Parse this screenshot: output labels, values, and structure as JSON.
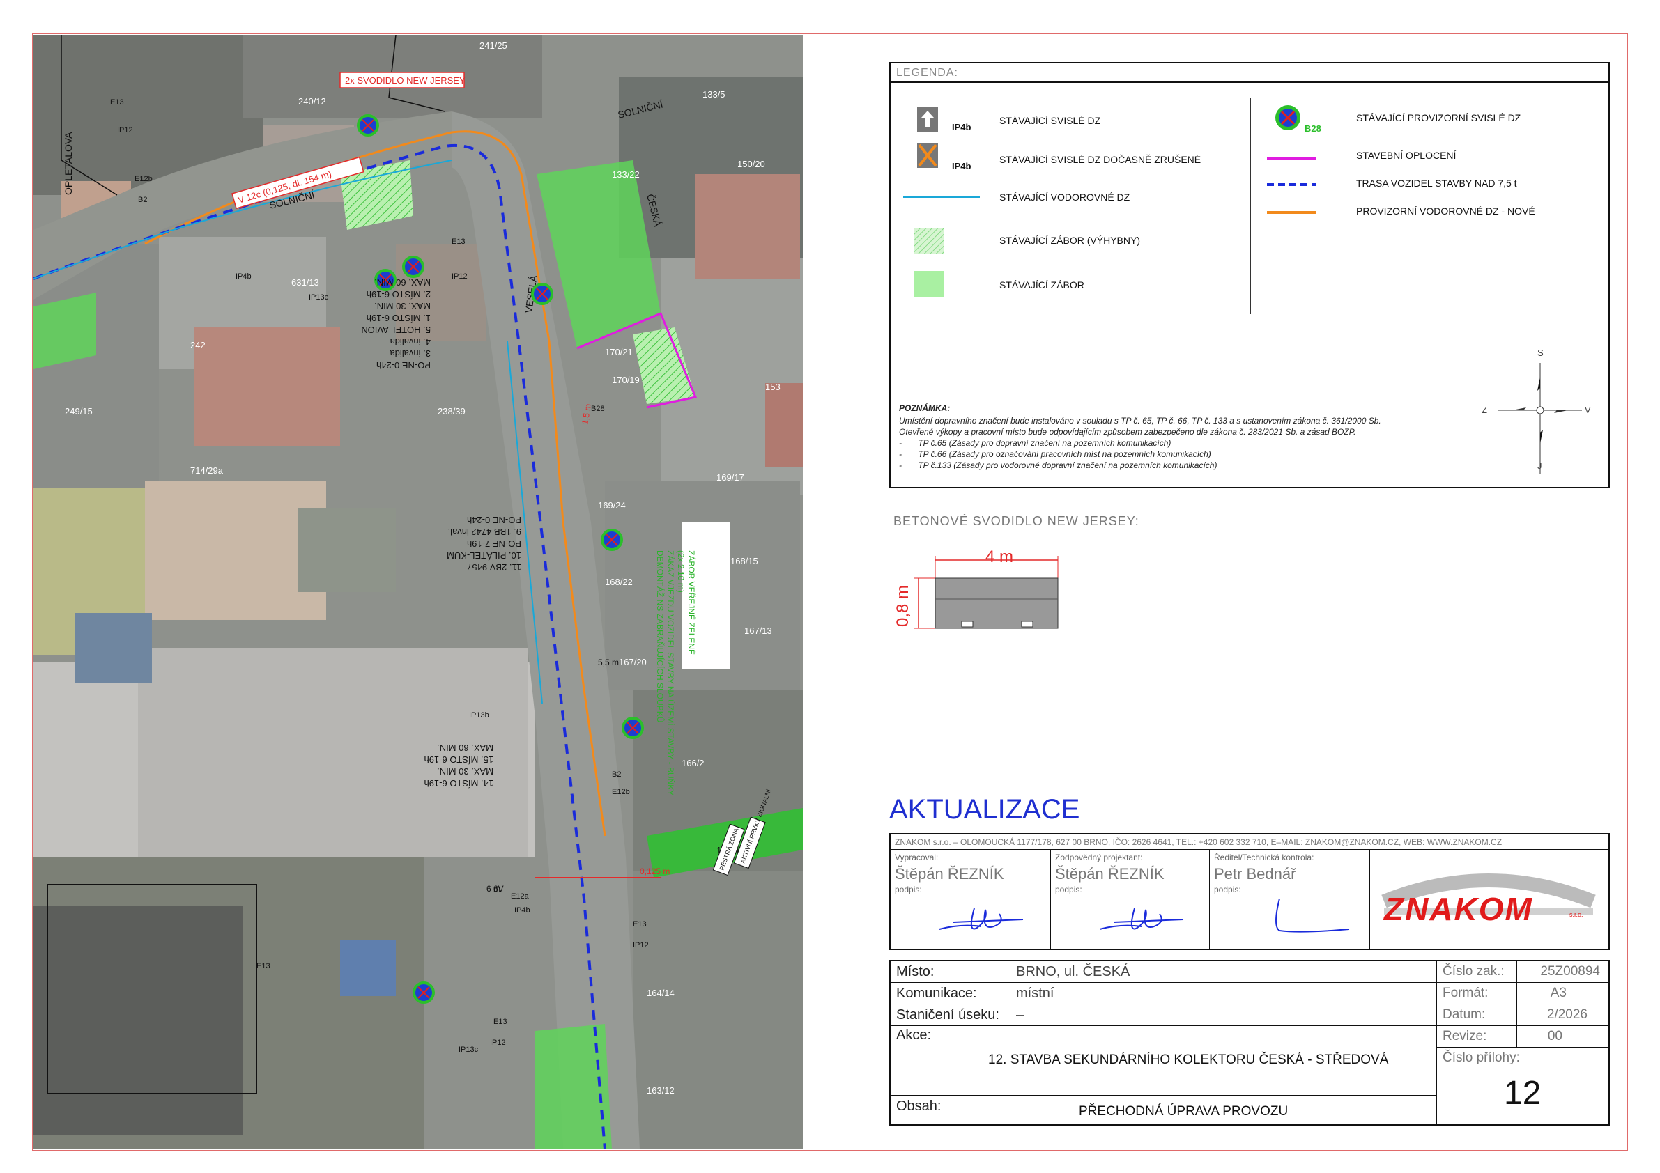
{
  "legend": {
    "header": "LEGENDA:",
    "items": [
      {
        "code": "IP4b",
        "label": "STÁVAJÍCÍ SVISLÉ DZ"
      },
      {
        "code": "IP4b",
        "label": "STÁVAJÍCÍ SVISLÉ DZ DOČASNĚ ZRUŠENÉ"
      },
      {
        "code": "",
        "label": "STÁVAJÍCÍ VODOROVNÉ DZ"
      },
      {
        "code": "",
        "label": "STÁVAJÍCÍ ZÁBOR (VÝHYBNY)"
      },
      {
        "code": "",
        "label": "STÁVAJÍCÍ ZÁBOR"
      },
      {
        "code": "B28",
        "label": "STÁVAJÍCÍ PROVIZORNÍ SVISLÉ DZ"
      },
      {
        "code": "",
        "label": "STAVEBNÍ OPLOCENÍ"
      },
      {
        "code": "",
        "label": "TRASA VOZIDEL STAVBY NAD 7,5 t"
      },
      {
        "code": "",
        "label": "PROVIZORNÍ VODOROVNÉ DZ - NOVÉ"
      }
    ],
    "note_title": "POZNÁMKA:",
    "note_lines": [
      "Umístění dopravního značení bude instalováno v souladu s  TP č. 65, TP č. 66, TP č. 133 a s ustanovením zákona č. 361/2000 Sb.",
      "Otevřené výkopy a pracovní místo bude odpovídajícím způsobem zabezpečeno dle zákona č. 283/2021 Sb. a zásad BOZP."
    ],
    "note_bullets": [
      "TP č.65 (Zásady pro dopravní značení na pozemních komunikacích)",
      "TP č.66 (Zásady pro označování pracovních míst na pozemních komunikacích)",
      "TP č.133 (Zásady pro vodorovné dopravní značení na pozemních komunikacích)"
    ],
    "compass": {
      "n": "S",
      "s": "J",
      "w": "Z",
      "e": "V"
    }
  },
  "jersey": {
    "title": "BETONOVÉ SVODIDLO NEW JERSEY:",
    "length": "4 m",
    "height": "0,8 m"
  },
  "update_heading": "AKTUALIZACE",
  "title_block": {
    "company_line": "ZNAKOM s.r.o. – OLOMOUCKÁ 1177/178, 627 00 BRNO, IČO: 2626 4641, TEL.: +420 602 332 710, E–MAIL: ZNAKOM@ZNAKOM.CZ, WEB: WWW.ZNAKOM.CZ",
    "cells": [
      {
        "label": "Vypracoval:",
        "name": "Štěpán ŘEZNÍK",
        "sign": "podpis:"
      },
      {
        "label": "Zodpovědný projektant:",
        "name": "Štěpán ŘEZNÍK",
        "sign": "podpis:"
      },
      {
        "label": "Ředitel/Technická kontrola:",
        "name": "Petr Bednář",
        "sign": "podpis:"
      }
    ],
    "logo_text": "ZNAKOM",
    "logo_sub": "s.r.o."
  },
  "bottom_table": {
    "misto_label": "Místo:",
    "misto": "BRNO, ul. ČESKÁ",
    "komunikace_label": "Komunikace:",
    "komunikace": "místní",
    "staniceni_label": "Staničení úseku:",
    "staniceni": "–",
    "akce_label": "Akce:",
    "akce": "12. STAVBA SEKUNDÁRNÍHO KOLEKTORU ČESKÁ - STŘEDOVÁ",
    "obsah_label": "Obsah:",
    "obsah": "PŘECHODNÁ ÚPRAVA PROVOZU",
    "cislo_zak_label": "Číslo zak.:",
    "cislo_zak": "25Z00894",
    "format_label": "Formát:",
    "format": "A3",
    "datum_label": "Datum:",
    "datum": "2/2026",
    "revize_label": "Revize:",
    "revize": "00",
    "priloha_label": "Číslo přílohy:",
    "priloha": "12"
  },
  "map": {
    "street_names": [
      "SOLNIČNÍ",
      "SOLNIČNÍ",
      "OPLETALOVA",
      "VESELÁ",
      "ČESKÁ"
    ],
    "top_note": "2x SVODIDLO NEW JERSEY",
    "v12c_note": "V 12c (0,125, dl. 154 m)",
    "parcels": [
      "241/25",
      "240/12",
      "133/5",
      "133/22",
      "150/20",
      "631/13",
      "242",
      "249/15",
      "238/39",
      "714/29a",
      "170/21",
      "170/19",
      "169/17",
      "169/24",
      "168/15",
      "168/22",
      "167/13",
      "167/20",
      "166/2",
      "164/14",
      "163/12",
      "153"
    ],
    "signs": [
      "E13",
      "IP12",
      "E12b",
      "B2",
      "B28",
      "IP4b",
      "IP13c",
      "E13",
      "IP12",
      "IP13b",
      "B2",
      "E12b",
      "IP13c",
      "E13",
      "IP12",
      "E13",
      "IP12",
      "E13",
      "IP4b",
      "E12a"
    ],
    "parking_notes_1": [
      "PO-NE 0-24h",
      "3. invalida",
      "4. invalida",
      "5. HOTEL AVION",
      "1. MÍSTO 6-19h",
      "MAX. 30 MIN.",
      "2. MÍSTO 6-19h",
      "MAX. 60 MIN."
    ],
    "parking_notes_2": [
      "11. 2BV 9457",
      "10. PILÁTEL-KUM",
      "PO-NE 7-19h",
      "9. 1BB 4742 inval.",
      "PO-NE 0-24h"
    ],
    "parking_notes_3": [
      "14. MÍSTO 6-19h",
      "MAX. 30 MIN.",
      "15. MÍSTO 6-19h",
      "MAX. 60 MIN."
    ],
    "green_notes": [
      "ZÁBOR VEŘEJNÉ ZELENĚ",
      "(2x 2,10 m)",
      "ZÁKAZ VJEZDU VOZIDEL STAVBY NA ÚZEMÍ STAVBY - BUŇKY",
      "DEMONTÁŽ NS ZABRAŇUJÍCÍCH SLOUPKŮ"
    ],
    "dims": [
      "1,5 m",
      "5,5 m",
      "0,125 m",
      "105 m²",
      "6 m",
      "6V"
    ],
    "panel_texts": [
      "AKTIVNÍ PRVKY SIGNÁLNÍ",
      "PESTRÁ ZÓNA"
    ]
  }
}
